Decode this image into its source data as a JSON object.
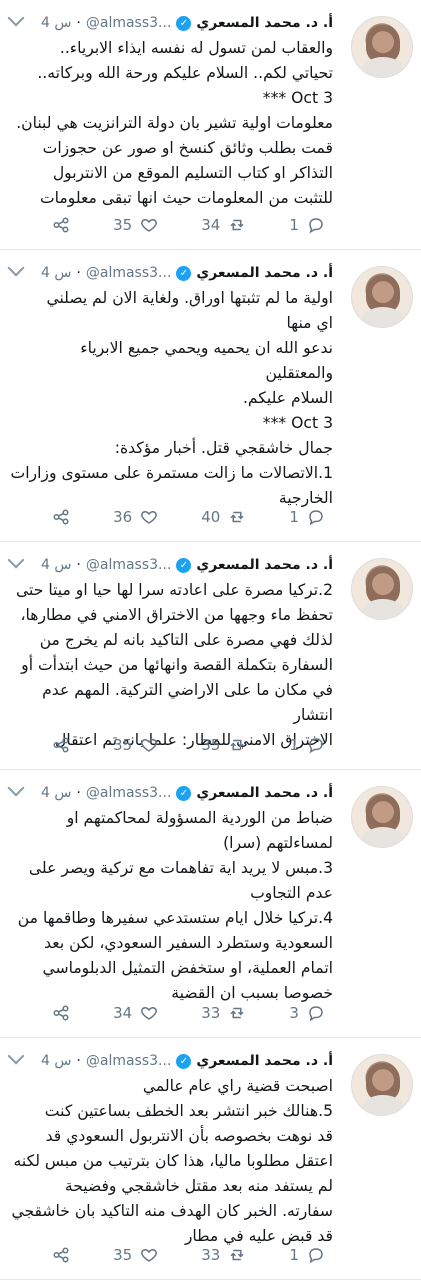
{
  "tweets": [
    {
      "name": "أ. د. محمد المسعري",
      "handle": "@almass3...",
      "time": "4 س",
      "body": "والعقاب لمن تسول له نفسه ايذاء الابرياء..\nتحياتي لكم.. السلام عليكم ورحة الله وبركاته..\nOct 3 ***\nمعلومات اولية تشير بان دولة الترانزيت هي لبنان.\nقمت بطلب وثائق كنسخ او صور عن حجوزات\nالتذاكر او كتاب التسليم الموقع من الانتربول\nللتثبت من المعلومات حيث انها تبقى معلومات",
      "shares": "",
      "likes": "35",
      "retweets": "34",
      "replies": "1"
    },
    {
      "name": "أ. د. محمد المسعري",
      "handle": "@almass3...",
      "time": "4 س",
      "body": "اولية ما لم تثبتها اوراق. ولغاية الان لم يصلني\nاي منها\nندعو الله ان يحميه ويحمي جميع الابرياء\nوالمعتقلين\nالسلام عليكم.\nOct 3 ***\nجمال خاشقجي قتل. أخبار مؤكدة:\n1.الاتصالات ما زالت مستمرة على مستوى وزارات\nالخارجية",
      "shares": "",
      "likes": "36",
      "retweets": "40",
      "replies": "1"
    },
    {
      "name": "أ. د. محمد المسعري",
      "handle": "@almass3...",
      "time": "4 س",
      "body": "2.تركيا مصرة على اعادته سرا لها حيا او ميتا حتى\nتحفظ ماء وجهها من الاختراق الامني في مطارها،\nلذلك فهي مصرة على التاكيد بانه لم يخرج من\nالسفارة بتكملة القصة وانهائها من حيث ابتدأت أو\nفي مكان ما على الاراضي التركية. المهم عدم انتشار\nالاختراق الامني للمطار: علما بانه تم اعتقال",
      "shares": "",
      "likes": "35",
      "retweets": "35",
      "replies": "1"
    },
    {
      "name": "أ. د. محمد المسعري",
      "handle": "@almass3...",
      "time": "4 س",
      "body": "ضباط من الوردية المسؤولة لمحاكمتهم او\nلمساءلتهم (سرا)\n3.مبس لا يريد اية تفاهمات مع تركية ويصر على\nعدم التجاوب\n4.تركيا خلال ايام ستستدعي سفيرها وطاقمها من\nالسعودية وستطرد السفير السعودي، لكن بعد\nاتمام العملية، او ستخفض التمثيل الدبلوماسي\nخصوصا بسبب ان القضية",
      "shares": "",
      "likes": "34",
      "retweets": "33",
      "replies": "3"
    },
    {
      "name": "أ. د. محمد المسعري",
      "handle": "@almass3...",
      "time": "4 س",
      "body": "اصبحت قضية راي عام عالمي\n5.هنالك خبر انتشر بعد الخطف بساعتين كنت\nقد نوهت بخصوصه بأن الانتربول السعودي قد\nاعتقل مطلوبا ماليا، هذا كان بترتيب من مبس لكنه\nلم يستفد منه بعد مقتل خاشقجي وفضيحة\nسفارته. الخبر كان الهدف منه التاكيد بان خاشقجي\nقد قبض عليه في مطار",
      "shares": "",
      "likes": "35",
      "retweets": "33",
      "replies": "1"
    }
  ]
}
